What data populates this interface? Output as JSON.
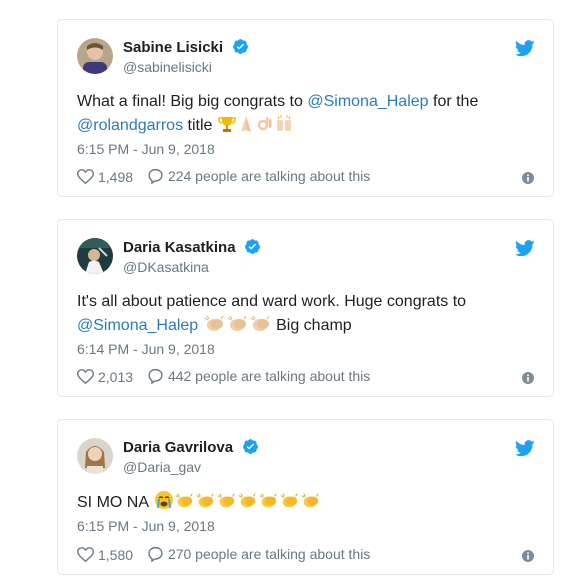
{
  "tweets": [
    {
      "name": "Sabine Lisicki",
      "handle": "@sabinelisicki",
      "text_lines": [
        [
          {
            "t": "What a final! Big big congrats to "
          },
          {
            "t": "@Simona_Halep",
            "m": true
          },
          {
            "t": " for the"
          }
        ],
        [
          {
            "t": "@rolandgarros",
            "m": true
          },
          {
            "t": " title "
          }
        ]
      ],
      "emojis": [
        "trophy",
        "pray-light",
        "ok-hand",
        "raised-hands"
      ],
      "time": "6:15 PM - Jun 9, 2018",
      "likes": "1,498",
      "talking": "224 people are talking about this"
    },
    {
      "name": "Daria Kasatkina",
      "handle": "@DKasatkina",
      "text_lines": [
        [
          {
            "t": "It's all about patience and ward work. Huge congrats to"
          }
        ],
        [
          {
            "t": "@Simona_Halep",
            "m": true
          },
          {
            "t": " "
          }
        ]
      ],
      "text_after_emoji": " Big champ",
      "emojis": [
        "clap",
        "clap",
        "clap"
      ],
      "time": "6:14 PM - Jun 9, 2018",
      "likes": "2,013",
      "talking": "442 people are talking about this"
    },
    {
      "name": "Daria Gavrilova",
      "handle": "@Daria_gav",
      "text_lines": [
        [
          {
            "t": "SI MO NA "
          }
        ]
      ],
      "emojis": [
        "sob",
        "clap",
        "clap",
        "clap",
        "clap",
        "clap",
        "clap",
        "clap"
      ],
      "time": "6:15 PM - Jun 9, 2018",
      "likes": "1,580",
      "talking": "270 people are talking about this"
    }
  ],
  "colors": {
    "mention": "#2b7bb9",
    "secondary": "#697882",
    "verified": "#1da1f2",
    "border": "#e1e8ed"
  },
  "icons": [
    "verified-badge-icon",
    "twitter-bird-icon",
    "heart-icon",
    "comment-bubble-icon",
    "info-icon"
  ]
}
